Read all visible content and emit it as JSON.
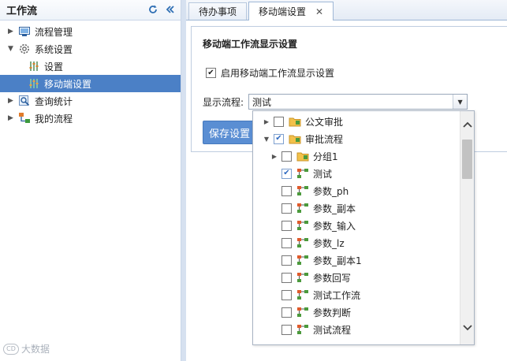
{
  "left": {
    "title": "工作流",
    "nav": [
      {
        "label": "流程管理",
        "expanded": false
      },
      {
        "label": "系统设置",
        "expanded": true
      },
      {
        "label": "设置"
      },
      {
        "label": "移动端设置",
        "selected": true
      },
      {
        "label": "查询统计",
        "expanded": false
      },
      {
        "label": "我的流程",
        "expanded": false
      }
    ]
  },
  "tabs": [
    {
      "label": "待办事项"
    },
    {
      "label": "移动端设置",
      "active": true
    }
  ],
  "panel": {
    "title": "移动端工作流显示设置",
    "enable_label": "启用移动端工作流显示设置",
    "enable_checked": true,
    "field_label": "显示流程:",
    "select_value": "测试",
    "save_label": "保存设置"
  },
  "dropdown": {
    "items": [
      {
        "label": "公文审批",
        "type": "folder",
        "arrow": "right",
        "checked": false
      },
      {
        "label": "审批流程",
        "type": "folder",
        "arrow": "down",
        "checked": true
      },
      {
        "label": "分组1",
        "type": "folder",
        "arrow": "right",
        "checked": false
      },
      {
        "label": "测试",
        "type": "flow",
        "checked": true
      },
      {
        "label": "参数_ph",
        "type": "flow",
        "checked": false
      },
      {
        "label": "参数_副本",
        "type": "flow",
        "checked": false
      },
      {
        "label": "参数_输入",
        "type": "flow",
        "checked": false
      },
      {
        "label": "参数_lz",
        "type": "flow",
        "checked": false
      },
      {
        "label": "参数_副本1",
        "type": "flow",
        "checked": false
      },
      {
        "label": "参数回写",
        "type": "flow",
        "checked": false
      },
      {
        "label": "测试工作流",
        "type": "flow",
        "checked": false
      },
      {
        "label": "参数判断",
        "type": "flow",
        "checked": false
      },
      {
        "label": "测试流程",
        "type": "flow",
        "checked": false
      }
    ]
  },
  "watermark": "大数据"
}
